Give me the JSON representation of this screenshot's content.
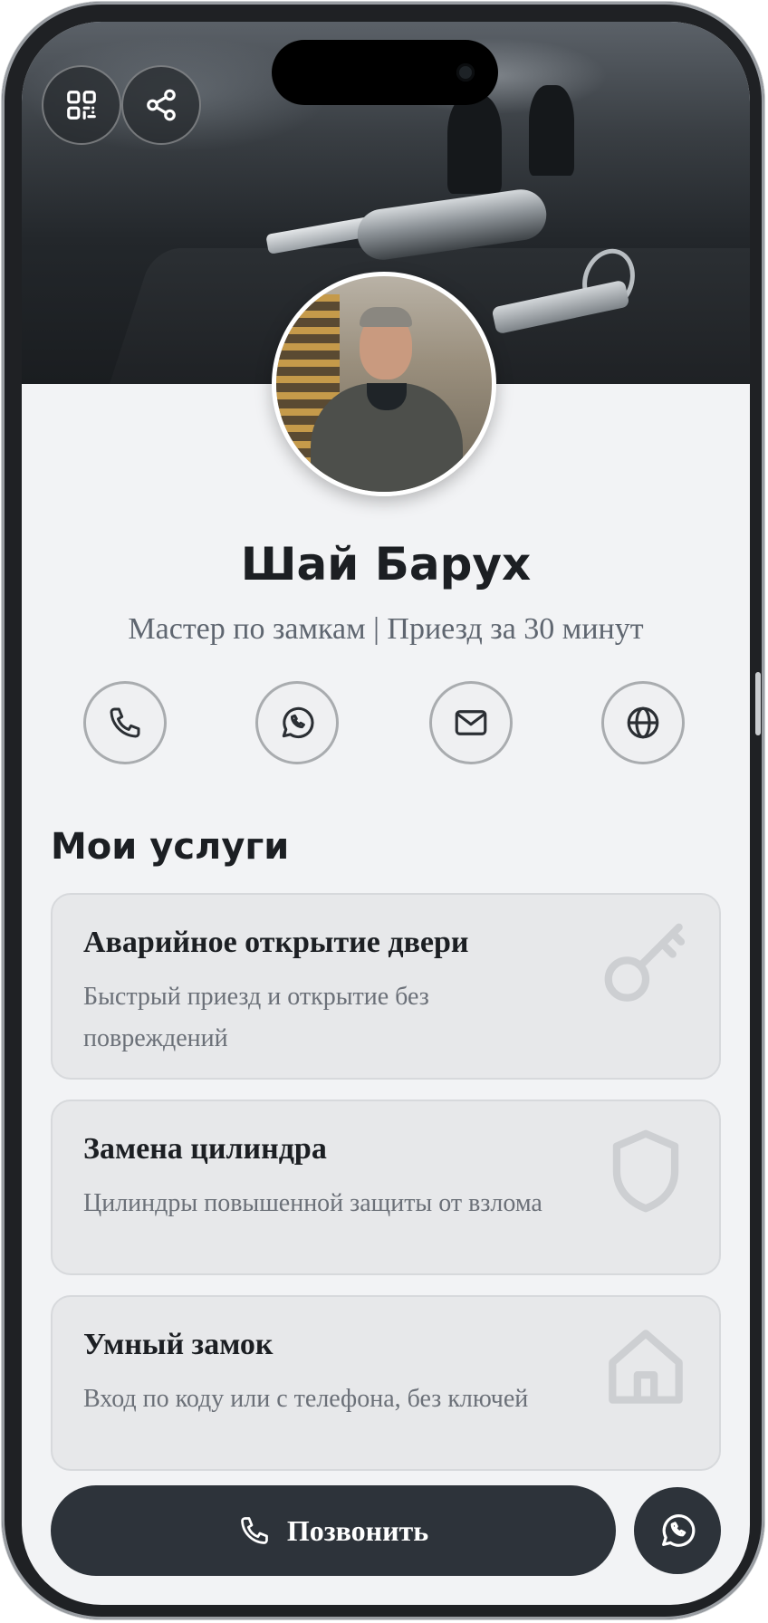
{
  "profile": {
    "name": "Шай Барух",
    "subtitle": "Мастер по замкам | Приезд за 30 минут"
  },
  "top_actions": {
    "qr_icon": "qr-code-icon",
    "share_icon": "share-icon"
  },
  "contact_actions": [
    {
      "icon": "phone-icon"
    },
    {
      "icon": "whatsapp-icon"
    },
    {
      "icon": "mail-icon"
    },
    {
      "icon": "globe-icon"
    }
  ],
  "services": {
    "title": "Мои услуги",
    "items": [
      {
        "title": "Аварийное открытие двери",
        "description": "Быстрый приезд и открытие без повреждений",
        "icon": "key-icon"
      },
      {
        "title": "Замена цилиндра",
        "description": "Цилиндры повышенной защиты от взлома",
        "icon": "shield-icon"
      },
      {
        "title": "Умный замок",
        "description": "Вход по коду или с телефона, без ключей",
        "icon": "home-icon"
      }
    ]
  },
  "bottom_bar": {
    "call_label": "Позвонить",
    "call_icon": "phone-icon",
    "whatsapp_icon": "whatsapp-icon"
  },
  "colors": {
    "dark_button": "#2d333a",
    "page_background": "#f2f3f5",
    "card_background": "#e7e8ea",
    "text_primary": "#1c1f23",
    "text_secondary": "#6b7078"
  }
}
